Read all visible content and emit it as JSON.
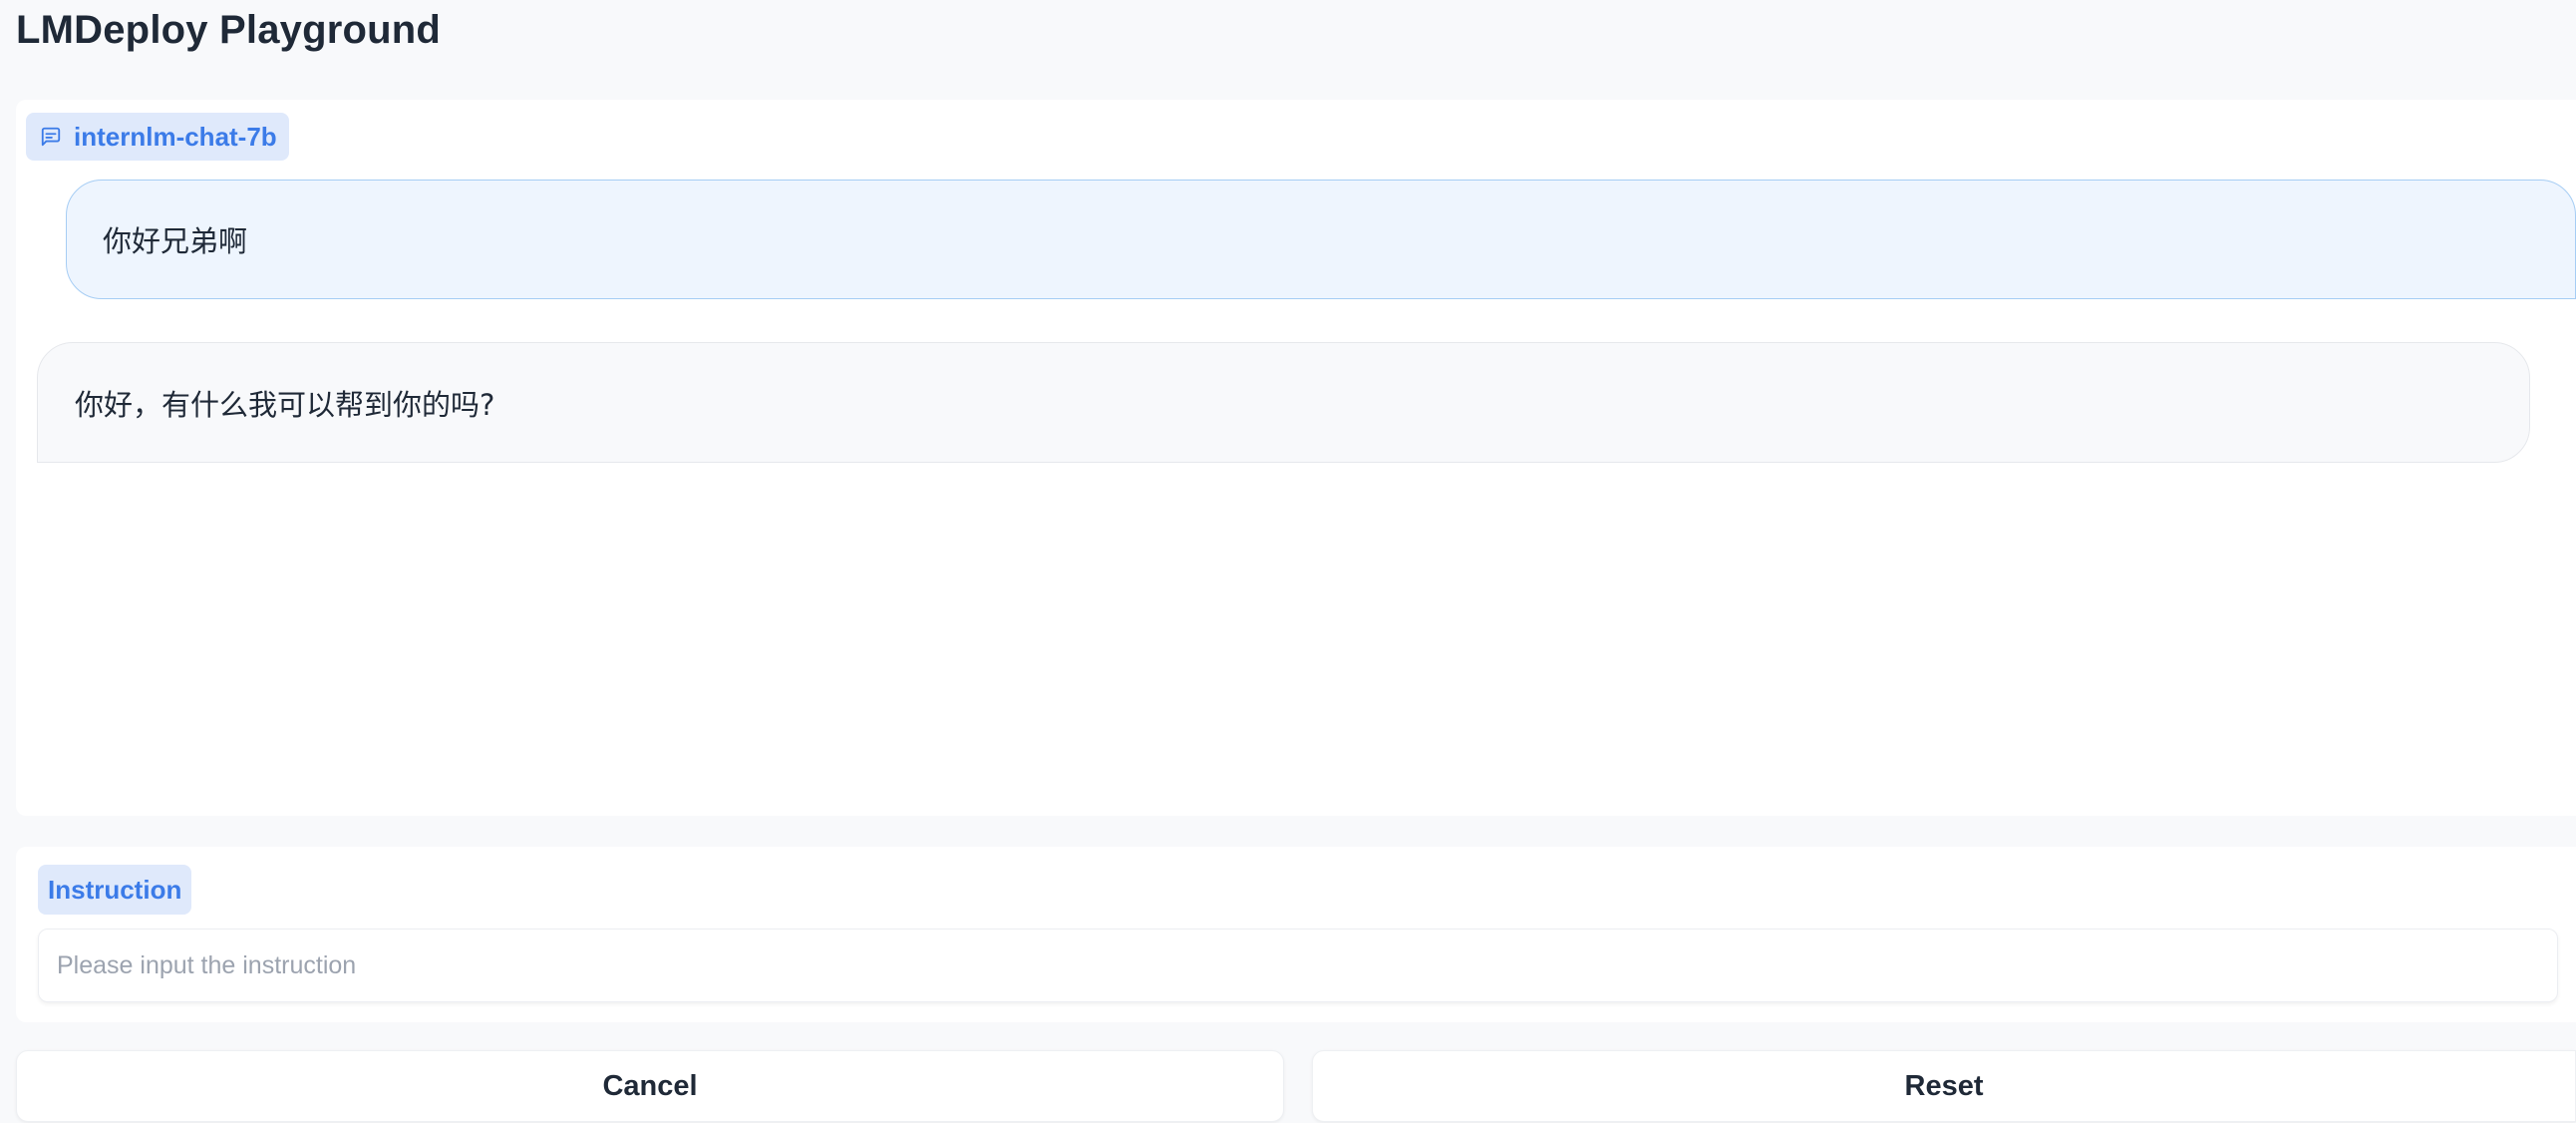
{
  "app": {
    "title": "LMDeploy Playground"
  },
  "chatbot": {
    "label": "internlm-chat-7b",
    "label_icon": "chat-bubble-icon",
    "messages": [
      {
        "role": "user",
        "text": "你好兄弟啊"
      },
      {
        "role": "assistant",
        "text": "你好，有什么我可以帮到你的吗?"
      }
    ]
  },
  "instruction": {
    "label": "Instruction",
    "value": "",
    "placeholder": "Please input the instruction"
  },
  "buttons": {
    "cancel_label": "Cancel",
    "reset_label": "Reset"
  },
  "colors": {
    "accent": "#3b7be8",
    "label_bg": "#dfe9fb",
    "user_bubble_bg": "#eef5fe",
    "user_bubble_border": "#a6cdf4",
    "bot_bubble_bg": "#f8f9fb",
    "page_bg": "#f8f9fb"
  }
}
